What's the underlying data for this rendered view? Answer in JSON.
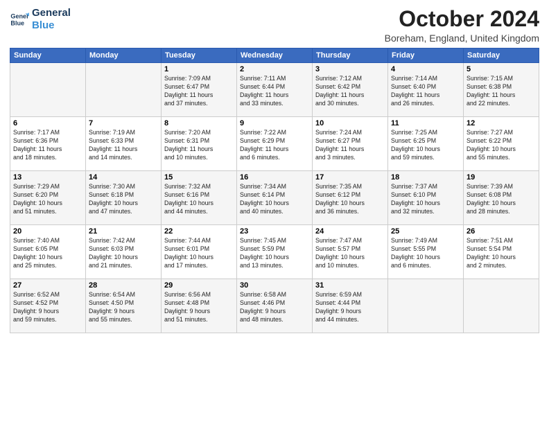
{
  "logo": {
    "line1": "General",
    "line2": "Blue"
  },
  "title": "October 2024",
  "location": "Boreham, England, United Kingdom",
  "headers": [
    "Sunday",
    "Monday",
    "Tuesday",
    "Wednesday",
    "Thursday",
    "Friday",
    "Saturday"
  ],
  "weeks": [
    [
      {
        "day": "",
        "text": ""
      },
      {
        "day": "",
        "text": ""
      },
      {
        "day": "1",
        "text": "Sunrise: 7:09 AM\nSunset: 6:47 PM\nDaylight: 11 hours\nand 37 minutes."
      },
      {
        "day": "2",
        "text": "Sunrise: 7:11 AM\nSunset: 6:44 PM\nDaylight: 11 hours\nand 33 minutes."
      },
      {
        "day": "3",
        "text": "Sunrise: 7:12 AM\nSunset: 6:42 PM\nDaylight: 11 hours\nand 30 minutes."
      },
      {
        "day": "4",
        "text": "Sunrise: 7:14 AM\nSunset: 6:40 PM\nDaylight: 11 hours\nand 26 minutes."
      },
      {
        "day": "5",
        "text": "Sunrise: 7:15 AM\nSunset: 6:38 PM\nDaylight: 11 hours\nand 22 minutes."
      }
    ],
    [
      {
        "day": "6",
        "text": "Sunrise: 7:17 AM\nSunset: 6:36 PM\nDaylight: 11 hours\nand 18 minutes."
      },
      {
        "day": "7",
        "text": "Sunrise: 7:19 AM\nSunset: 6:33 PM\nDaylight: 11 hours\nand 14 minutes."
      },
      {
        "day": "8",
        "text": "Sunrise: 7:20 AM\nSunset: 6:31 PM\nDaylight: 11 hours\nand 10 minutes."
      },
      {
        "day": "9",
        "text": "Sunrise: 7:22 AM\nSunset: 6:29 PM\nDaylight: 11 hours\nand 6 minutes."
      },
      {
        "day": "10",
        "text": "Sunrise: 7:24 AM\nSunset: 6:27 PM\nDaylight: 11 hours\nand 3 minutes."
      },
      {
        "day": "11",
        "text": "Sunrise: 7:25 AM\nSunset: 6:25 PM\nDaylight: 10 hours\nand 59 minutes."
      },
      {
        "day": "12",
        "text": "Sunrise: 7:27 AM\nSunset: 6:22 PM\nDaylight: 10 hours\nand 55 minutes."
      }
    ],
    [
      {
        "day": "13",
        "text": "Sunrise: 7:29 AM\nSunset: 6:20 PM\nDaylight: 10 hours\nand 51 minutes."
      },
      {
        "day": "14",
        "text": "Sunrise: 7:30 AM\nSunset: 6:18 PM\nDaylight: 10 hours\nand 47 minutes."
      },
      {
        "day": "15",
        "text": "Sunrise: 7:32 AM\nSunset: 6:16 PM\nDaylight: 10 hours\nand 44 minutes."
      },
      {
        "day": "16",
        "text": "Sunrise: 7:34 AM\nSunset: 6:14 PM\nDaylight: 10 hours\nand 40 minutes."
      },
      {
        "day": "17",
        "text": "Sunrise: 7:35 AM\nSunset: 6:12 PM\nDaylight: 10 hours\nand 36 minutes."
      },
      {
        "day": "18",
        "text": "Sunrise: 7:37 AM\nSunset: 6:10 PM\nDaylight: 10 hours\nand 32 minutes."
      },
      {
        "day": "19",
        "text": "Sunrise: 7:39 AM\nSunset: 6:08 PM\nDaylight: 10 hours\nand 28 minutes."
      }
    ],
    [
      {
        "day": "20",
        "text": "Sunrise: 7:40 AM\nSunset: 6:05 PM\nDaylight: 10 hours\nand 25 minutes."
      },
      {
        "day": "21",
        "text": "Sunrise: 7:42 AM\nSunset: 6:03 PM\nDaylight: 10 hours\nand 21 minutes."
      },
      {
        "day": "22",
        "text": "Sunrise: 7:44 AM\nSunset: 6:01 PM\nDaylight: 10 hours\nand 17 minutes."
      },
      {
        "day": "23",
        "text": "Sunrise: 7:45 AM\nSunset: 5:59 PM\nDaylight: 10 hours\nand 13 minutes."
      },
      {
        "day": "24",
        "text": "Sunrise: 7:47 AM\nSunset: 5:57 PM\nDaylight: 10 hours\nand 10 minutes."
      },
      {
        "day": "25",
        "text": "Sunrise: 7:49 AM\nSunset: 5:55 PM\nDaylight: 10 hours\nand 6 minutes."
      },
      {
        "day": "26",
        "text": "Sunrise: 7:51 AM\nSunset: 5:54 PM\nDaylight: 10 hours\nand 2 minutes."
      }
    ],
    [
      {
        "day": "27",
        "text": "Sunrise: 6:52 AM\nSunset: 4:52 PM\nDaylight: 9 hours\nand 59 minutes."
      },
      {
        "day": "28",
        "text": "Sunrise: 6:54 AM\nSunset: 4:50 PM\nDaylight: 9 hours\nand 55 minutes."
      },
      {
        "day": "29",
        "text": "Sunrise: 6:56 AM\nSunset: 4:48 PM\nDaylight: 9 hours\nand 51 minutes."
      },
      {
        "day": "30",
        "text": "Sunrise: 6:58 AM\nSunset: 4:46 PM\nDaylight: 9 hours\nand 48 minutes."
      },
      {
        "day": "31",
        "text": "Sunrise: 6:59 AM\nSunset: 4:44 PM\nDaylight: 9 hours\nand 44 minutes."
      },
      {
        "day": "",
        "text": ""
      },
      {
        "day": "",
        "text": ""
      }
    ]
  ]
}
